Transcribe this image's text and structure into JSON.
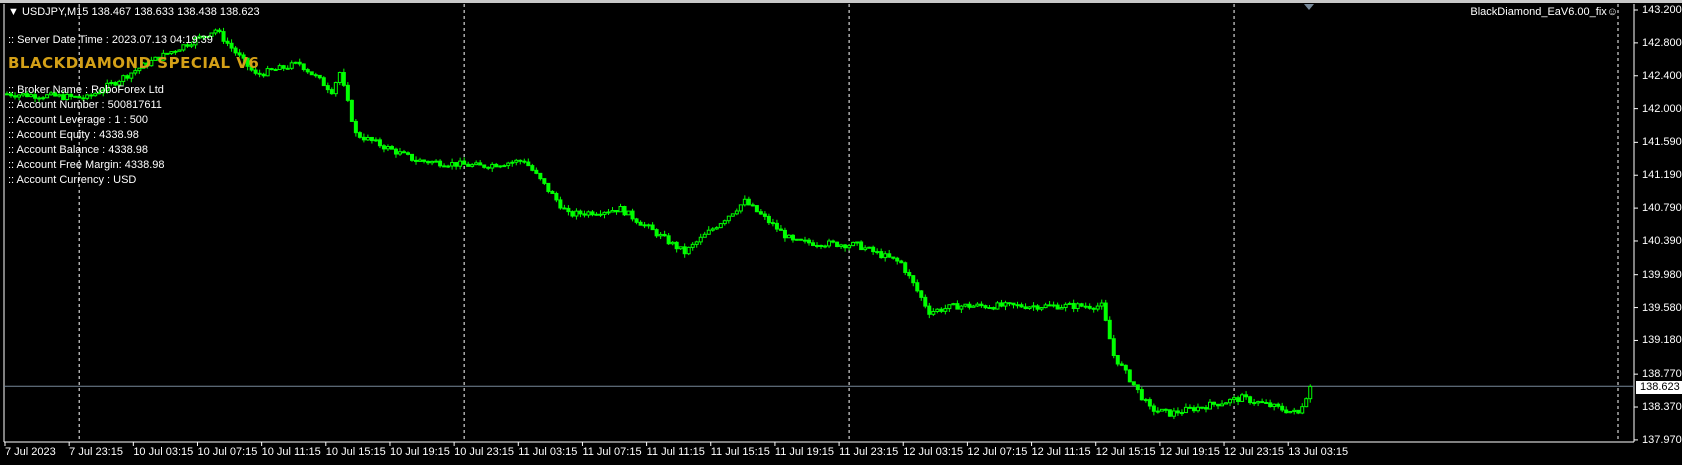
{
  "header": {
    "symbol_timeframe": "USDJPY,M15",
    "ohlc": "138.467 138.633 138.438 138.623",
    "ea_name": "BlackDiamond_EaV6.00_fix",
    "ea_icon": "smiley-icon"
  },
  "info": {
    "server_time": ":: Server Date Time : 2023.07.13 04:19:39",
    "brand": "BLACKDIAMOND SPECIAL V6",
    "broker": ":: Broker Name : RoboForex Ltd",
    "account_number": ":: Account Number : 500817611",
    "leverage": ":: Account Leverage : 1 : 500",
    "equity": ":: Account Equity : 4338.98",
    "balance": ":: Account Balance : 4338.98",
    "free_margin": ":: Account Free Margin: 4338.98",
    "currency": ":: Account Currency : USD"
  },
  "colors": {
    "candle": "#00ff00",
    "grid_sep": "#ffffff",
    "bid_line": "#778899",
    "brand": "#d4a017"
  },
  "chart_data": {
    "type": "candlestick",
    "current_price": "138.623",
    "price_ticks": [
      "143.200",
      "142.800",
      "142.400",
      "142.000",
      "141.590",
      "141.190",
      "140.790",
      "140.390",
      "139.980",
      "139.580",
      "139.180",
      "138.770",
      "138.370",
      "137.970"
    ],
    "price_range": [
      137.97,
      143.2
    ],
    "time_ticks": [
      "7 Jul 2023",
      "7 Jul 23:15",
      "10 Jul 03:15",
      "10 Jul 07:15",
      "10 Jul 11:15",
      "10 Jul 15:15",
      "10 Jul 19:15",
      "10 Jul 23:15",
      "11 Jul 03:15",
      "11 Jul 07:15",
      "11 Jul 11:15",
      "11 Jul 15:15",
      "11 Jul 19:15",
      "11 Jul 23:15",
      "12 Jul 03:15",
      "12 Jul 07:15",
      "12 Jul 11:15",
      "12 Jul 15:15",
      "12 Jul 19:15",
      "12 Jul 23:15",
      "13 Jul 03:15"
    ],
    "bars_per_time_tick": 16,
    "day_separator_bars": [
      18,
      114,
      210,
      306
    ],
    "close_path": [
      [
        0,
        142.18
      ],
      [
        20,
        142.13
      ],
      [
        35,
        142.55
      ],
      [
        52,
        142.96
      ],
      [
        62,
        142.41
      ],
      [
        73,
        142.55
      ],
      [
        81,
        142.22
      ],
      [
        83,
        142.44
      ],
      [
        87,
        141.69
      ],
      [
        102,
        141.37
      ],
      [
        118,
        141.3
      ],
      [
        129,
        141.37
      ],
      [
        140,
        140.71
      ],
      [
        153,
        140.78
      ],
      [
        169,
        140.25
      ],
      [
        184,
        140.87
      ],
      [
        196,
        140.38
      ],
      [
        212,
        140.34
      ],
      [
        223,
        140.12
      ],
      [
        230,
        139.53
      ],
      [
        237,
        139.6
      ],
      [
        253,
        139.6
      ],
      [
        273,
        139.6
      ],
      [
        276,
        139.0
      ],
      [
        285,
        138.35
      ],
      [
        290,
        138.29
      ],
      [
        308,
        138.48
      ],
      [
        322,
        138.29
      ],
      [
        325,
        138.62
      ]
    ]
  }
}
